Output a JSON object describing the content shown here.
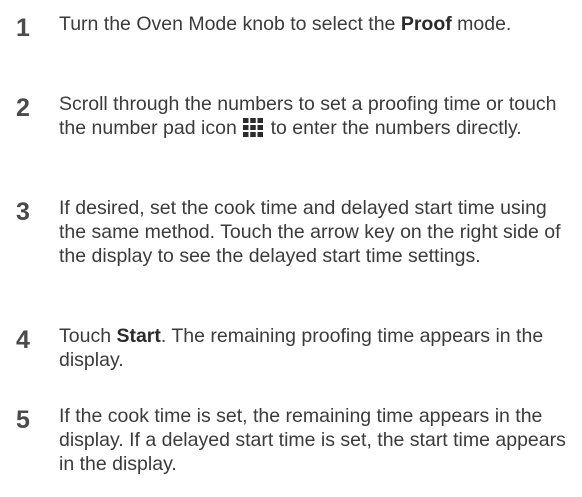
{
  "steps": [
    {
      "number": "1",
      "text_before": "Turn the Oven Mode knob to select the ",
      "bold": "Proof",
      "text_after": " mode."
    },
    {
      "number": "2",
      "text_before": "Scroll through the numbers to set a proofing time or touch the number pad icon ",
      "icon": "number-pad-icon",
      "text_after": " to enter the numbers directly."
    },
    {
      "number": "3",
      "text": "If desired, set the cook time and delayed start time using the same method. Touch the arrow key on the right side of the display to see the delayed start time settings."
    },
    {
      "number": "4",
      "text_before": "Touch ",
      "bold": "Start",
      "text_after": ". The remaining proofing time appears in the display."
    },
    {
      "number": "5",
      "text": "If the cook time is set, the remaining time appears in the display. If a delayed start time is set, the start time appears in the display."
    }
  ],
  "colors": {
    "text": "#3b3b3b",
    "number": "#4a4a4a",
    "icon": "#2b2b2b"
  }
}
